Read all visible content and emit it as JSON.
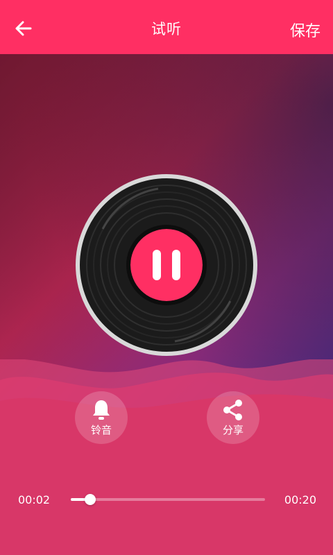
{
  "header": {
    "title": "试听",
    "save_label": "保存",
    "back_icon": "arrow-left-icon"
  },
  "player": {
    "state": "playing",
    "control_icon": "pause-icon",
    "accent_color": "#ff2f63",
    "current_time": "00:02",
    "total_time": "00:20",
    "progress": 0.1
  },
  "actions": {
    "ringtone_label": "铃音",
    "ringtone_icon": "bell-icon",
    "share_label": "分享",
    "share_icon": "share-icon"
  }
}
